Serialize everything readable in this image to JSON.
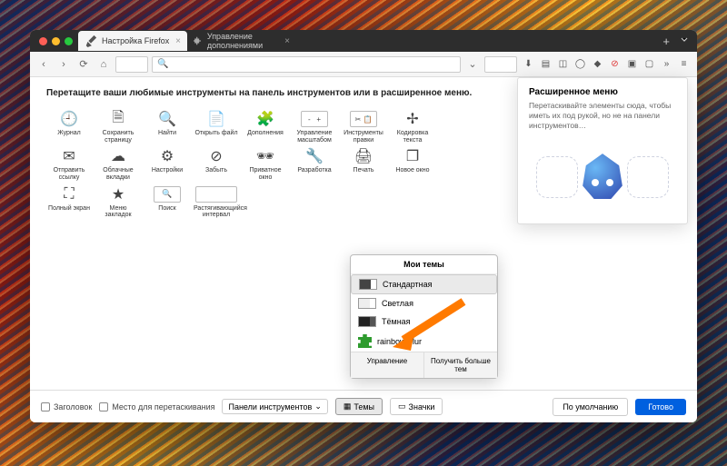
{
  "tabs": {
    "active": {
      "label": "Настройка Firefox"
    },
    "inactive": {
      "label": "Управление дополнениями"
    }
  },
  "instruction": "Перетащите ваши любимые инструменты на панель инструментов или в расширенное меню.",
  "tools": [
    {
      "id": "history",
      "label": "Журнал"
    },
    {
      "id": "save-page",
      "label": "Сохранить страницу"
    },
    {
      "id": "find",
      "label": "Найти"
    },
    {
      "id": "open-file",
      "label": "Открыть файл"
    },
    {
      "id": "addons",
      "label": "Дополнения"
    },
    {
      "id": "zoom",
      "label": "Управление масштабом"
    },
    {
      "id": "edit-tools",
      "label": "Инструменты правки"
    },
    {
      "id": "encoding",
      "label": "Кодировка текста"
    },
    {
      "id": "email-link",
      "label": "Отправить ссылку"
    },
    {
      "id": "cloud-tabs",
      "label": "Облачные вкладки"
    },
    {
      "id": "settings",
      "label": "Настройки"
    },
    {
      "id": "forget",
      "label": "Забыть"
    },
    {
      "id": "private",
      "label": "Приватное окно"
    },
    {
      "id": "developer",
      "label": "Разработка"
    },
    {
      "id": "print",
      "label": "Печать"
    },
    {
      "id": "new-window",
      "label": "Новое окно"
    },
    {
      "id": "fullscreen",
      "label": "Полный экран"
    },
    {
      "id": "bookmarks-menu",
      "label": "Меню закладок"
    },
    {
      "id": "search",
      "label": "Поиск"
    },
    {
      "id": "flex-spacer",
      "label": "Растягивающийся интервал"
    }
  ],
  "overflow": {
    "title": "Расширенное меню",
    "desc": "Перетаскивайте элементы сюда, чтобы иметь их под рукой, но не на панели инструментов…"
  },
  "themes": {
    "header": "Мои темы",
    "items": [
      {
        "id": "default",
        "label": "Стандартная",
        "selected": true
      },
      {
        "id": "light",
        "label": "Светлая"
      },
      {
        "id": "dark",
        "label": "Тёмная"
      },
      {
        "id": "rainbow",
        "label": "rainbow blur"
      }
    ],
    "manage": "Управление",
    "more": "Получить больше тем"
  },
  "bottom": {
    "title_cb": "Заголовок",
    "drag_cb": "Место для перетаскивания",
    "toolbars": "Панели инструментов",
    "themes_btn": "Темы",
    "icons_btn": "Значки",
    "default_btn": "По умолчанию",
    "done_btn": "Готово"
  }
}
